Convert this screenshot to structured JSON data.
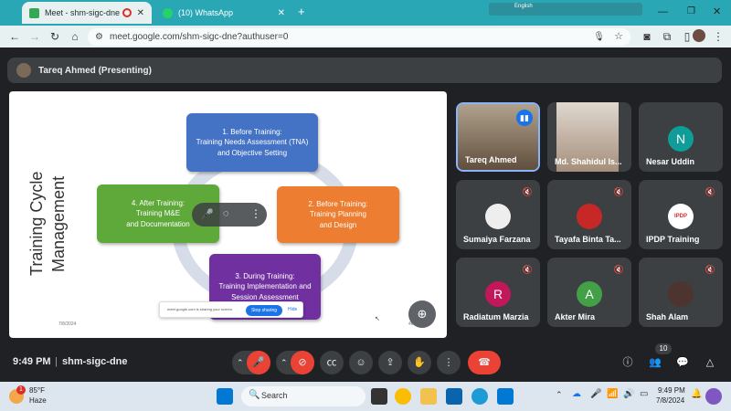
{
  "browser": {
    "tabs": [
      {
        "title": "Meet - shm-sigc-dne",
        "active": true
      },
      {
        "title": "(10) WhatsApp",
        "active": false
      }
    ],
    "new_tab": "+",
    "url": "meet.google.com/shm-sigc-dne?authuser=0",
    "language": "English"
  },
  "presenter": {
    "label": "Tareq Ahmed (Presenting)"
  },
  "slide": {
    "title_line1": "Training Cycle",
    "title_line2": "Management",
    "box1": {
      "l1": "1. Before Training:",
      "l2": "Training Needs Assessment (TNA)",
      "l3": "and Objective Setting"
    },
    "box2": {
      "l1": "2. Before Training:",
      "l2": "Training Planning",
      "l3": "and Design"
    },
    "box3": {
      "l1": "3. During Training:",
      "l2": "Training Implementation and",
      "l3": "Session Assessment"
    },
    "box4": {
      "l1": "4. After Training:",
      "l2": "Training M&E",
      "l3": "and Documentation"
    },
    "date": "7/8/2024",
    "page": "46",
    "share_notice": "meet.google.com is sharing your screen.",
    "stop_sharing": "Stop sharing",
    "hide": "Hide"
  },
  "participants": [
    {
      "name": "Tareq Ahmed",
      "type": "video"
    },
    {
      "name": "Md. Shahidul Is...",
      "type": "video"
    },
    {
      "name": "Nesar Uddin",
      "initial": "N",
      "color": "#0f9d9a"
    },
    {
      "name": "Sumaiya Farzana",
      "type": "photo"
    },
    {
      "name": "Tayafa Binta Ta...",
      "type": "photo"
    },
    {
      "name": "IPDP Training",
      "type": "logo",
      "logo_text": "IPDP"
    },
    {
      "name": "Radiatum Marzia",
      "initial": "R",
      "color": "#c2185b"
    },
    {
      "name": "Akter Mira",
      "initial": "A",
      "color": "#43a047"
    },
    {
      "name": "Shah Alam",
      "type": "photo"
    }
  ],
  "meeting": {
    "time": "9:49 PM",
    "code": "shm-sigc-dne",
    "people_count": "10",
    "separator": "|"
  },
  "taskbar": {
    "weather_temp": "85°F",
    "weather_desc": "Haze",
    "search_placeholder": "Search",
    "clock_time": "9:49 PM",
    "clock_date": "7/8/2024"
  }
}
